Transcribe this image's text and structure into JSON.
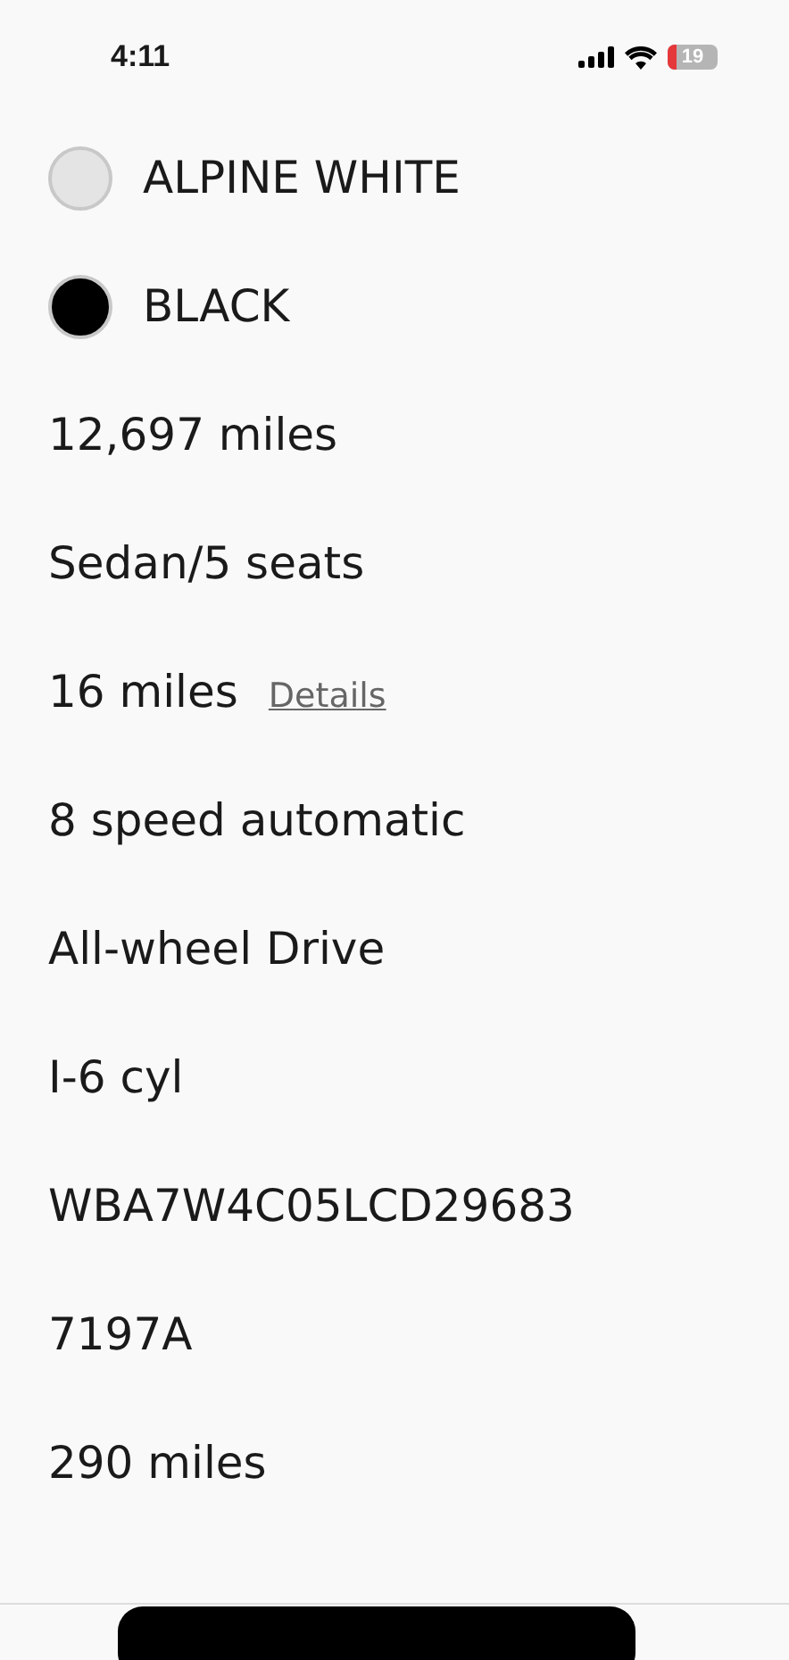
{
  "status_bar": {
    "time": "4:11",
    "battery": "19"
  },
  "colors": [
    {
      "name": "ALPINE WHITE",
      "color": "#e4e4e4"
    },
    {
      "name": "BLACK",
      "color": "#000000"
    }
  ],
  "specs": [
    {
      "value": "12,697 miles"
    },
    {
      "value": "Sedan/5 seats"
    },
    {
      "value": "16 miles",
      "link": "Details"
    },
    {
      "value": "8 speed automatic"
    },
    {
      "value": "All-wheel Drive"
    },
    {
      "value": "I-6 cyl"
    },
    {
      "value": "WBA7W4C05LCD29683"
    },
    {
      "value": "7197A"
    },
    {
      "value": "290 miles"
    }
  ]
}
